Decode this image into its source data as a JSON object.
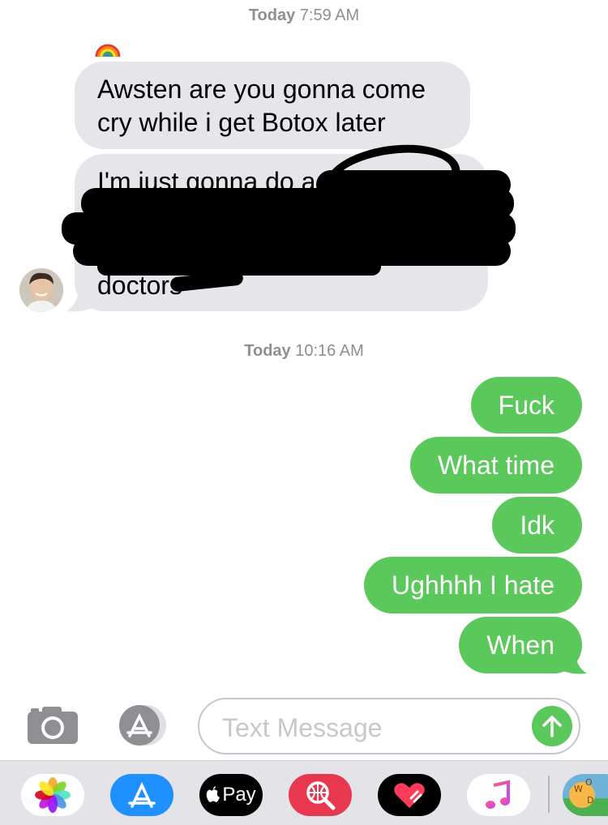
{
  "timestamps": [
    {
      "day": "Today",
      "time": " 7:59 AM"
    },
    {
      "day": "Today",
      "time": " 10:16 AM"
    }
  ],
  "tapback_icon": "rainbow-icon",
  "incoming": [
    {
      "text": "Awsten are you gonna come cry while i get Botox later"
    },
    {
      "text": "I'm just gonna do a",
      "redacted_tail": "doctors"
    }
  ],
  "outgoing": [
    {
      "text": "Fuck"
    },
    {
      "text": "What time"
    },
    {
      "text": "Idk"
    },
    {
      "text": "Ughhhh I hate"
    },
    {
      "text": "When"
    }
  ],
  "composer": {
    "placeholder": "Text Message",
    "value": ""
  },
  "apps": {
    "apple_pay_label": "Pay",
    "icons": [
      "photos-icon",
      "app-store-icon",
      "apple-pay-icon",
      "search-images-icon",
      "digital-touch-icon",
      "music-icon",
      "word-game-icon"
    ]
  },
  "colors": {
    "outgoing": "#5ac85a",
    "incoming": "#e5e5ea",
    "timestamp": "#8e8e93"
  }
}
